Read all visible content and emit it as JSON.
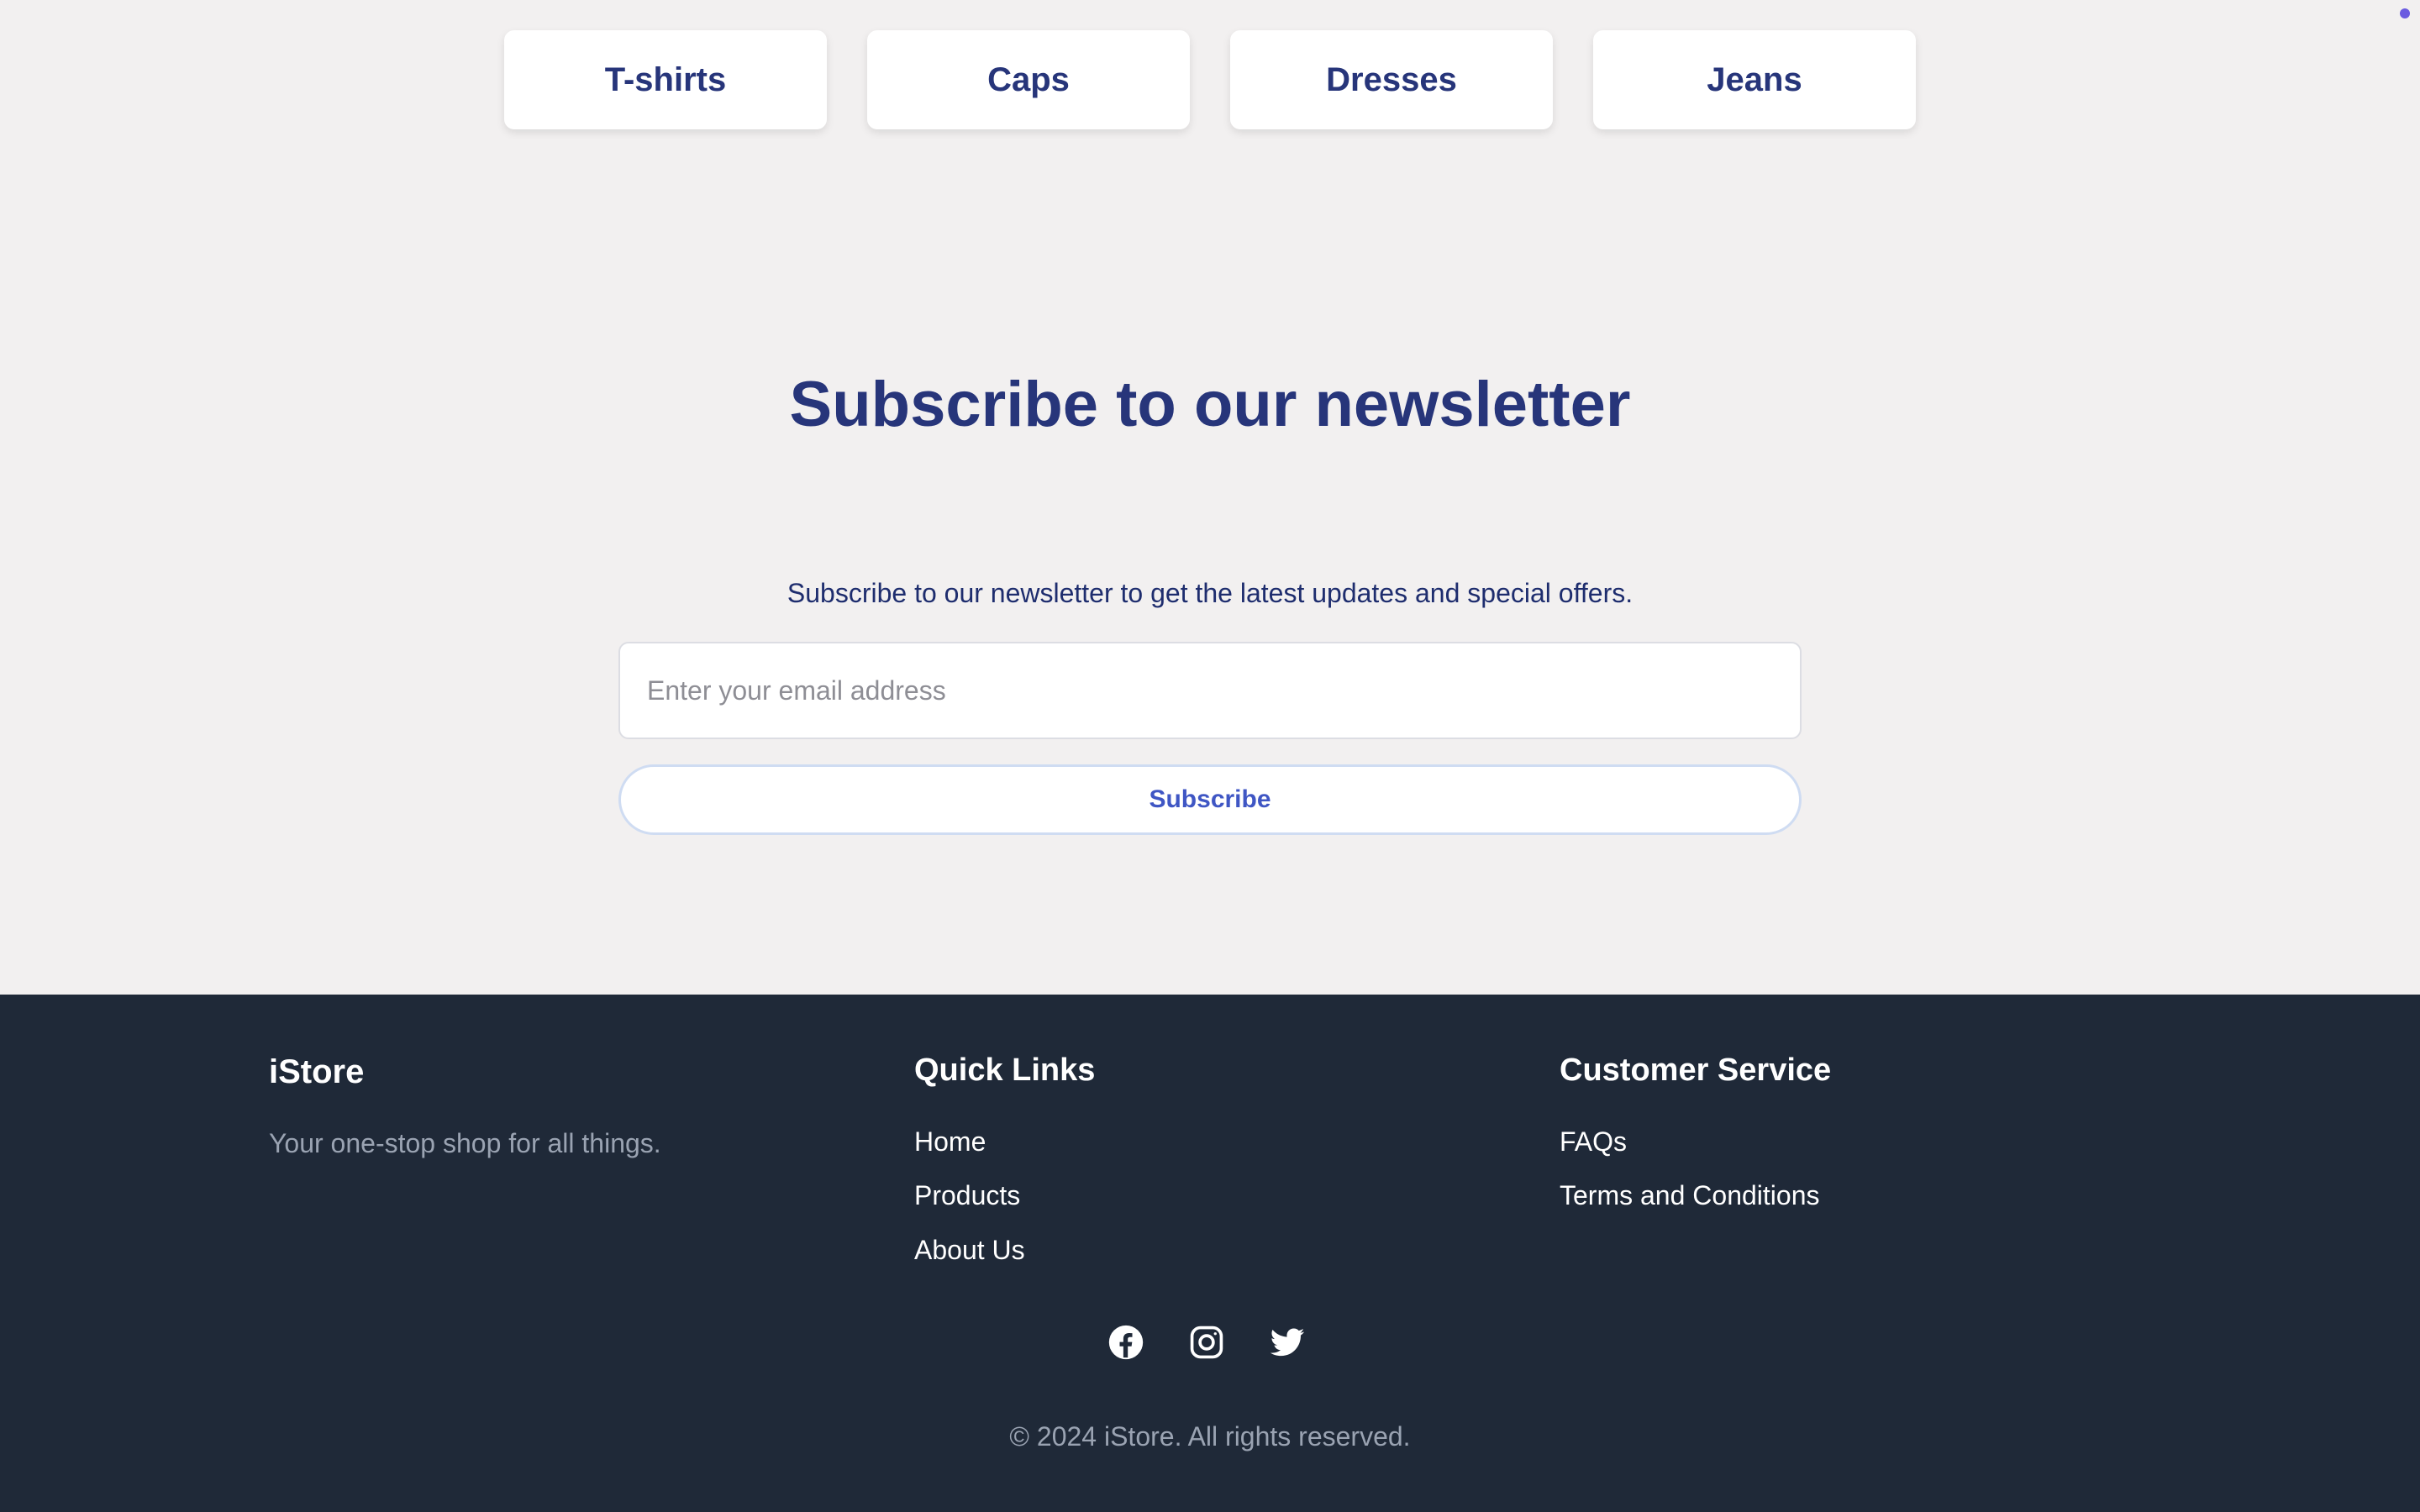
{
  "categories": [
    {
      "label": "T-shirts"
    },
    {
      "label": "Caps"
    },
    {
      "label": "Dresses"
    },
    {
      "label": "Jeans"
    }
  ],
  "newsletter": {
    "title": "Subscribe to our newsletter",
    "description": "Subscribe to our newsletter to get the latest updates and special offers.",
    "email_placeholder": "Enter your email address",
    "email_value": "",
    "button_label": "Subscribe"
  },
  "footer": {
    "brand": {
      "title": "iStore",
      "tagline": "Your one-stop shop for all things."
    },
    "quick_links": {
      "title": "Quick Links",
      "items": [
        {
          "label": "Home"
        },
        {
          "label": "Products"
        },
        {
          "label": "About Us"
        }
      ]
    },
    "customer_service": {
      "title": "Customer Service",
      "items": [
        {
          "label": "FAQs"
        },
        {
          "label": "Terms and Conditions"
        }
      ]
    },
    "social": [
      "facebook-icon",
      "instagram-icon",
      "twitter-icon"
    ],
    "copyright": "© 2024 iStore. All rights reserved."
  },
  "colors": {
    "accent": "#27357a",
    "button_text": "#3f56c4",
    "footer_bg": "#1f2938",
    "page_bg": "#f2f0f0"
  }
}
